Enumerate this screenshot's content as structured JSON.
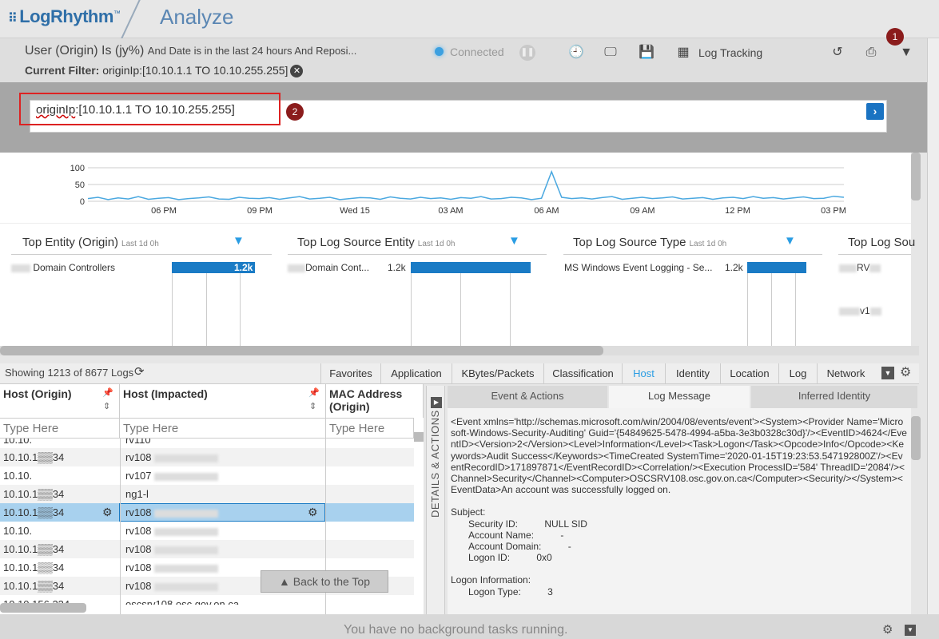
{
  "app": {
    "logo": "LogRhythm",
    "title": "Analyze"
  },
  "query": {
    "summary_main": "User (Origin) Is (jy%)",
    "summary_rest": "And Date is in the last 24 hours And Reposi...",
    "current_filter_label": "Current Filter:",
    "current_filter_value": "originIp:[10.10.1.1 TO 10.10.255.255]"
  },
  "toolbar": {
    "status": "Connected",
    "log_tracking": "Log Tracking",
    "icons": [
      "pause-icon",
      "clock-icon",
      "monitor-icon",
      "save-icon",
      "layout-icon",
      "undo-icon",
      "print-icon",
      "filter-icon"
    ]
  },
  "annotations": {
    "badge1": "1",
    "badge2": "2"
  },
  "filter_input": {
    "prefix": "originIp",
    "rest": ":[10.10.1.1 TO 10.10.255.255]"
  },
  "chart_data": {
    "type": "line",
    "y_ticks": [
      "100",
      "50",
      "0"
    ],
    "x_ticks": [
      "06 PM",
      "09 PM",
      "Wed 15",
      "03 AM",
      "06 AM",
      "09 AM",
      "12 PM",
      "03 PM"
    ],
    "ylim": [
      0,
      100
    ],
    "series": [
      {
        "values": [
          8,
          12,
          5,
          10,
          7,
          14,
          6,
          9,
          11,
          5,
          8,
          10,
          13,
          7,
          6,
          12,
          9,
          8,
          11,
          6,
          10,
          14,
          7,
          9,
          12,
          5,
          8,
          11,
          10,
          6,
          13,
          9,
          7,
          12,
          8,
          10,
          6,
          11,
          9,
          14,
          7,
          8,
          12,
          10,
          5,
          9,
          88,
          12,
          8,
          10,
          7,
          11,
          14,
          6,
          9,
          12,
          8,
          10,
          13,
          7,
          9,
          11,
          6,
          10,
          12,
          8,
          14,
          9,
          11,
          7,
          10,
          13,
          8,
          9,
          15,
          12
        ]
      }
    ]
  },
  "widgets": [
    {
      "title": "Top Entity (Origin)",
      "period": "Last 1d 0h",
      "label": "Domain Controllers",
      "value": "1.2k"
    },
    {
      "title": "Top Log Source Entity",
      "period": "Last 1d 0h",
      "label": "Domain Cont...",
      "value": "1.2k"
    },
    {
      "title": "Top Log Source Type",
      "period": "Last 1d 0h",
      "label": "MS Windows Event Logging - Se...",
      "value": "1.2k"
    },
    {
      "title": "Top Log Sou",
      "label1": "RV",
      "label2": "v1"
    }
  ],
  "grid": {
    "showing": "Showing 1213 of 8677 Logs",
    "tabs": [
      "Favorites",
      "Application",
      "KBytes/Packets",
      "Classification",
      "Host",
      "Identity",
      "Location",
      "Log",
      "Network"
    ],
    "active_tab": "Host",
    "columns": [
      "Host (Origin)",
      "Host (Impacted)",
      "MAC Address (Origin)"
    ],
    "filter_placeholder": "Type Here",
    "rows": [
      {
        "origin": "10.10.",
        "impacted": "rv110"
      },
      {
        "origin": "10.10.1▒▒34",
        "impacted": "rv108"
      },
      {
        "origin": "10.10.",
        "impacted": "rv107"
      },
      {
        "origin": "10.10.1▒▒34",
        "impacted": "ng1-l"
      },
      {
        "origin": "10.10.1▒▒34",
        "impacted": "rv108"
      },
      {
        "origin": "10.10.",
        "impacted": "rv108"
      },
      {
        "origin": "10.10.1▒▒34",
        "impacted": "rv108"
      },
      {
        "origin": "10.10.1▒▒34",
        "impacted": "rv108"
      },
      {
        "origin": "10.10.1▒▒34",
        "impacted": "rv108"
      },
      {
        "origin": "10.10.156.234",
        "impacted": "oscsrv108.osc.gov.on.ca"
      }
    ],
    "back_to_top": "Back to the Top"
  },
  "details": {
    "side_label": "DETAILS & ACTIONS",
    "tabs": [
      "Event & Actions",
      "Log Message",
      "Inferred Identity"
    ],
    "active_tab": "Log Message",
    "log_xml": "<Event xmlns='http://schemas.microsoft.com/win/2004/08/events/event'><System><Provider Name='Microsoft-Windows-Security-Auditing' Guid='{54849625-5478-4994-a5ba-3e3b0328c30d}'/><EventID>4624</EventID><Version>2</Version><Level>Information</Level><Task>Logon</Task><Opcode>Info</Opcode><Keywords>Audit Success</Keywords><TimeCreated SystemTime='2020-01-15T19:23:53.547192800Z'/><EventRecordID>171897871</EventRecordID><Correlation/><Execution ProcessID='584' ThreadID='2084'/><Channel>Security</Channel><Computer>OSCSRV108.osc.gov.on.ca</Computer><Security/></System><EventData>An account was successfully logged on.",
    "subject_header": "Subject:",
    "subject_lines": [
      "Security ID:          NULL SID",
      "Account Name:          -",
      "Account Domain:          -",
      "Logon ID:          0x0"
    ],
    "logon_header": "Logon Information:",
    "logon_lines": [
      "Logon Type:          3"
    ]
  },
  "status_bar": {
    "text": "You have no background tasks running."
  }
}
